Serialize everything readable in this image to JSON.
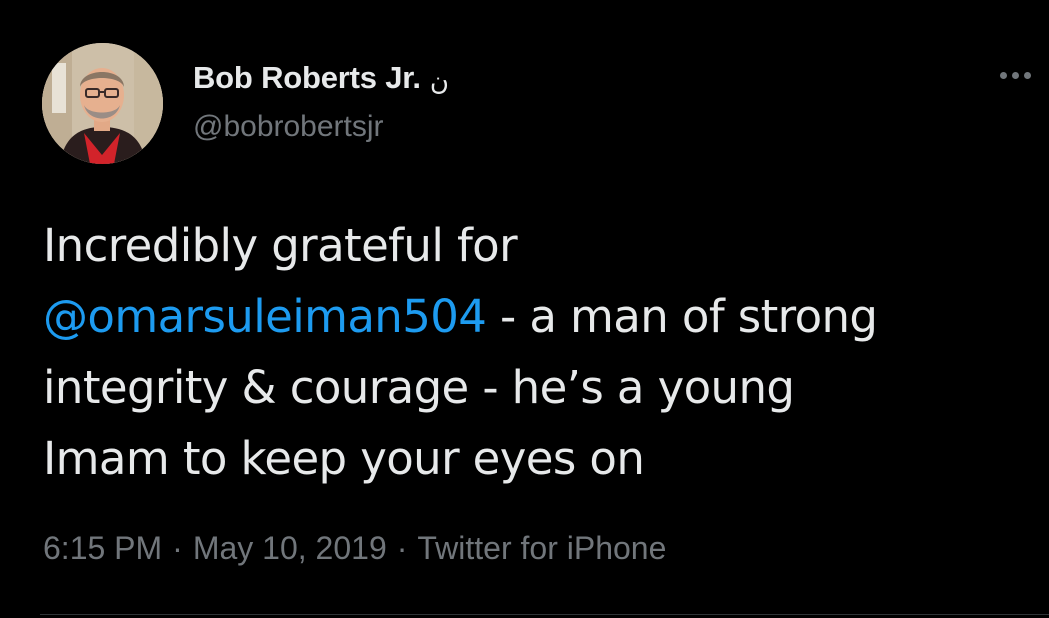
{
  "author": {
    "display_name": "Bob Roberts Jr.",
    "name_glyph": "ن",
    "handle": "@bobrobertsjr",
    "avatar_icon": "profile-photo"
  },
  "more_icon": "more-horizontal-icon",
  "tweet": {
    "text_line1": "Incredibly grateful for",
    "mention": "@omarsuleiman504",
    "text_after_mention": " - a man of strong",
    "text_line3": "integrity & courage - he’s a young",
    "text_line4": "Imam to keep your eyes on"
  },
  "meta": {
    "time": "6:15 PM",
    "separator": "·",
    "date": "May 10, 2019",
    "source": "Twitter for iPhone"
  },
  "colors": {
    "background": "#000000",
    "text": "#e7e9ea",
    "secondary": "#71767b",
    "link": "#1d9bf0"
  }
}
